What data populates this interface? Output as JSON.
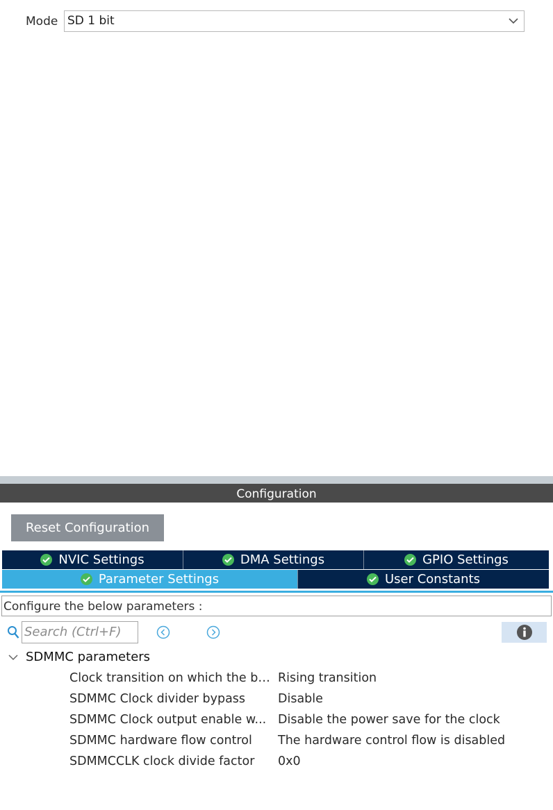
{
  "mode": {
    "label": "Mode",
    "value": "SD 1 bit"
  },
  "configuration": {
    "header": "Configuration",
    "reset_button": "Reset Configuration",
    "tabs_row1": [
      {
        "label": "NVIC Settings"
      },
      {
        "label": "DMA Settings"
      },
      {
        "label": "GPIO Settings"
      }
    ],
    "tabs_row2": [
      {
        "label": "Parameter Settings",
        "active": true
      },
      {
        "label": "User Constants"
      }
    ],
    "description": "Configure the below parameters :",
    "search": {
      "placeholder": "Search (Ctrl+F)"
    },
    "group": {
      "title": "SDMMC parameters",
      "params": [
        {
          "name": "Clock transition on which the bi...",
          "value": "Rising transition"
        },
        {
          "name": "SDMMC Clock divider bypass",
          "value": "Disable"
        },
        {
          "name": "SDMMC Clock output enable w...",
          "value": "Disable the power save for the clock"
        },
        {
          "name": "SDMMC hardware flow control",
          "value": "The hardware control flow is disabled"
        },
        {
          "name": "SDMMCCLK clock divide factor",
          "value": "0x0"
        }
      ]
    }
  },
  "colors": {
    "tab_bg": "#03234b",
    "tab_active_bg": "#3aaee0",
    "check_green": "#48b85a",
    "header_bg": "#4a4a4a",
    "reset_bg": "#8a9097"
  }
}
